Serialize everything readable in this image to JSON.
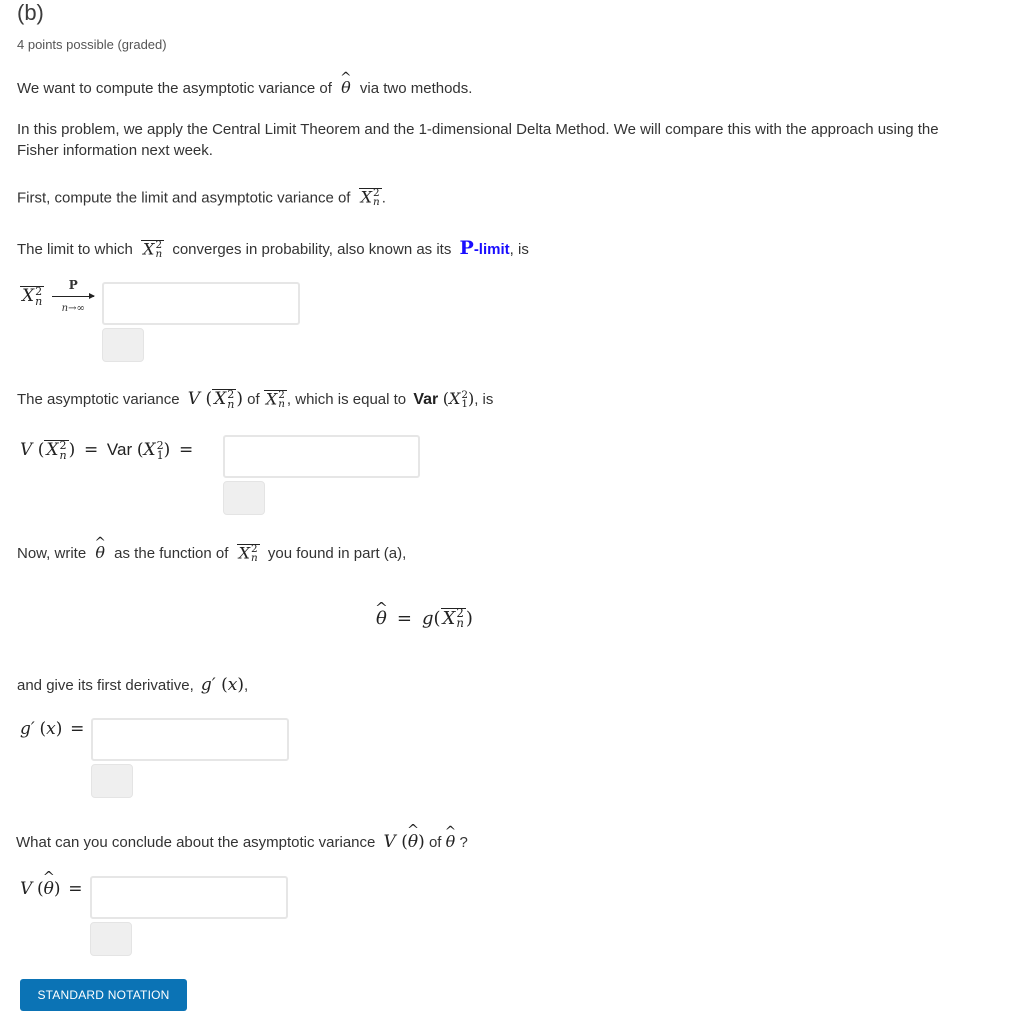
{
  "problem": {
    "title": "(b)",
    "points": "4 points possible (graded)",
    "intro": {
      "before": "We want to compute the asymptotic variance of",
      "after": "via two methods."
    },
    "method_text_line1": "In this problem, we apply the Central Limit Theorem and the 1-dimensional Delta Method. We will compare this with the approach using the",
    "method_text_line2": "Fisher information next week.",
    "first_compute": {
      "before": "First, compute the limit and asymptotic variance of",
      "after": "."
    },
    "limit_sentence": {
      "before": "The limit to which",
      "middle": "converges in probability, also known as its",
      "plimit_p": "P",
      "plimit_label": "-limit",
      "after": ", is"
    },
    "limit_equation": {
      "arrow_top": "P",
      "arrow_bottom": "n→∞"
    },
    "variance_sentence": {
      "before": "The asymptotic variance",
      "of": "of",
      "middle": ", which is equal to",
      "after": ", is"
    },
    "now_write": {
      "before": "Now, write",
      "middle": "as the function of",
      "after": "you found in part (a),"
    },
    "derivative_sentence": {
      "before": "and give its first derivative,",
      "after": ","
    },
    "conclude_sentence": {
      "before": "What can you conclude about the asymptotic variance",
      "of": "of",
      "after": "?"
    },
    "math": {
      "X": "X",
      "sup2": "2",
      "sub_n": "n",
      "sub_1": "1",
      "theta": "θ",
      "V": "V",
      "Var": "Var",
      "g": "g",
      "gprime": "g′",
      "x": "x",
      "equals": "=",
      "lparen": "(",
      "rparen": ")"
    },
    "answers": [
      {
        "name": "plimit",
        "value": ""
      },
      {
        "name": "asymptotic-variance-xbar",
        "value": ""
      },
      {
        "name": "g-prime",
        "value": ""
      },
      {
        "name": "asymptotic-variance-theta",
        "value": ""
      }
    ],
    "standard_notation_button": "STANDARD NOTATION"
  }
}
